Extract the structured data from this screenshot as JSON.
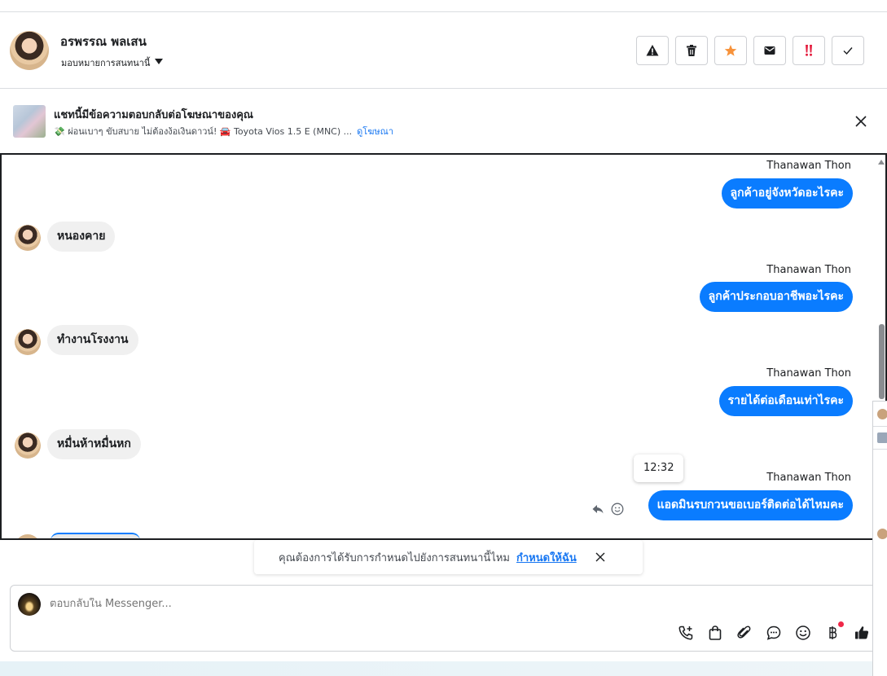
{
  "header": {
    "contact_name": "อรพรรณ พลเสน",
    "assign_label": "มอบหมายการสนทนานี้",
    "actions": [
      {
        "name": "report-spam-button",
        "icon": "warning-icon"
      },
      {
        "name": "delete-button",
        "icon": "trash-icon"
      },
      {
        "name": "star-button",
        "icon": "star-icon"
      },
      {
        "name": "mark-unread-button",
        "icon": "envelope-icon"
      },
      {
        "name": "follow-up-button",
        "icon": "exclamation-icon"
      },
      {
        "name": "mark-done-button",
        "icon": "check-icon"
      }
    ]
  },
  "banner": {
    "title": "แชทนี้มีข้อความตอบกลับต่อโฆษณาของคุณ",
    "ad_text": "💸 ผ่อนเบาๆ ขับสบาย ไม่ต้องง้อเงินดาวน์! 🚘 Toyota Vios 1.5 E (MNC) ...",
    "view_ad_link": "ดูโฆษณา"
  },
  "messages": [
    {
      "direction": "out",
      "sender": "Thanawan Thon",
      "text": "ลูกค้าอยู่จังหวัดอะไรคะ"
    },
    {
      "direction": "in",
      "text": "หนองคาย"
    },
    {
      "direction": "out",
      "sender": "Thanawan Thon",
      "text": "ลูกค้าประกอบอาชีพอะไรคะ"
    },
    {
      "direction": "in",
      "text": "ทำงานโรงงาน"
    },
    {
      "direction": "out",
      "sender": "Thanawan Thon",
      "text": "รายได้ต่อเดือนเท่าไรคะ"
    },
    {
      "direction": "in",
      "text": "หมื่นห้าหมื่นหก"
    },
    {
      "direction": "out",
      "sender": "Thanawan Thon",
      "text": "แอดมินรบกวนขอเบอร์ติดต่อได้ไหมคะ",
      "tooltip_time": "12:32"
    }
  ],
  "notice": {
    "text": "คุณต้องการได้รับการกำหนดไปยังการสนทนานี้ไหม",
    "link": "กำหนดให้ฉัน"
  },
  "composer": {
    "placeholder": "ตอบกลับใน Messenger...",
    "tools": [
      "call-icon",
      "shop-bag-icon",
      "paperclip-icon",
      "saved-reply-icon",
      "emoji-icon",
      "baht-icon",
      "thumbs-up-icon"
    ]
  },
  "colors": {
    "accent": "#0a7cff",
    "incoming_bubble": "#f0f0f0",
    "star": "#f7923a",
    "alert_red": "#e41e3f"
  }
}
